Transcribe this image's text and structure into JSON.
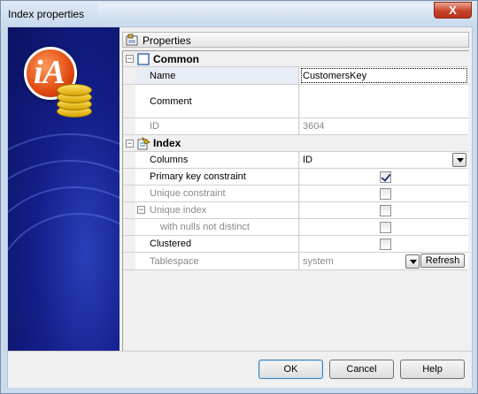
{
  "window": {
    "title": "Index properties",
    "close_label": "X"
  },
  "panel": {
    "header": "Properties"
  },
  "groups": {
    "common": {
      "label": "Common",
      "name_label": "Name",
      "name_value": "CustomersKey",
      "comment_label": "Comment",
      "comment_value": "",
      "id_label": "ID",
      "id_value": "3604"
    },
    "index": {
      "label": "Index",
      "columns_label": "Columns",
      "columns_value": "ID",
      "pk_label": "Primary key constraint",
      "pk_checked": true,
      "unique_label": "Unique constraint",
      "unique_checked": false,
      "unique_index_label": "Unique index",
      "unique_index_checked": false,
      "nulls_label": "with nulls not distinct",
      "nulls_checked": false,
      "clustered_label": "Clustered",
      "clustered_checked": false,
      "tablespace_label": "Tablespace",
      "tablespace_value": "system",
      "refresh_label": "Refresh"
    }
  },
  "buttons": {
    "ok": "OK",
    "cancel": "Cancel",
    "help": "Help"
  },
  "colors": {
    "banner": "#141f8a",
    "logo": "#e04a10",
    "accent": "#3c7fb1"
  }
}
